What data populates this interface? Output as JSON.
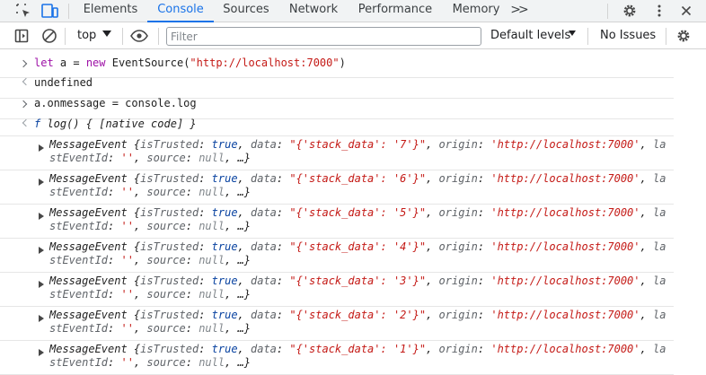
{
  "devtools": {
    "tabs": [
      "Elements",
      "Console",
      "Sources",
      "Network",
      "Performance",
      "Memory"
    ],
    "more_tabs_label": ">>",
    "active_tab": "Console"
  },
  "toolbar": {
    "context": "top",
    "filter_placeholder": "Filter",
    "levels": "Default levels",
    "issues": "No Issues"
  },
  "console": {
    "input1": {
      "kw1": "let",
      "mid": " a = ",
      "kw2": "new",
      "pre": " EventSource(",
      "str": "\"http://localhost:7000\"",
      "post": ")"
    },
    "result1": "undefined",
    "input2": "a.onmessage = console.log",
    "result2": {
      "f": "f",
      "rest": " log() { [native code] }"
    },
    "event_keys": {
      "type": "MessageEvent",
      "open": " {",
      "isTrusted": "isTrusted",
      "data": "data",
      "origin": "origin",
      "tail1": "la",
      "tail2": "stEventId",
      "source": "source",
      "end": "…}"
    },
    "event_values": {
      "trusted": "true",
      "origin": "'http://localhost:7000'",
      "lastEventId": "''",
      "source": "null"
    },
    "messages": [
      "\"{'stack_data': '7'}\"",
      "\"{'stack_data': '6'}\"",
      "\"{'stack_data': '5'}\"",
      "\"{'stack_data': '4'}\"",
      "\"{'stack_data': '3'}\"",
      "\"{'stack_data': '2'}\"",
      "\"{'stack_data': '1'}\""
    ]
  }
}
